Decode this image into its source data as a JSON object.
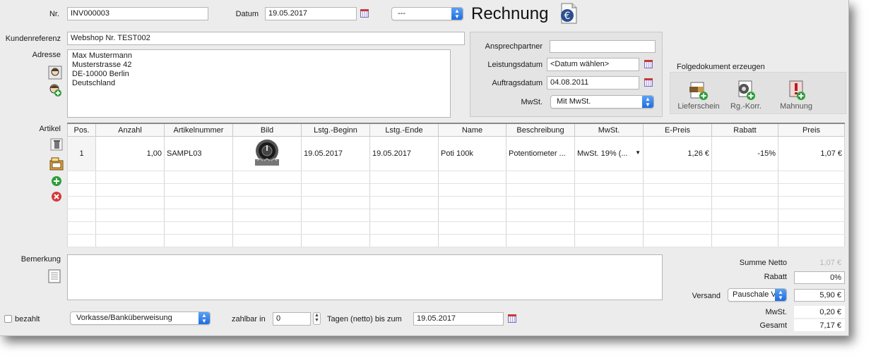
{
  "header": {
    "nr_label": "Nr.",
    "nr_value": "INV000003",
    "datum_label": "Datum",
    "datum_value": "19.05.2017",
    "type_select": "---",
    "doc_title": "Rechnung",
    "kundenreferenz_label": "Kundenreferenz",
    "kundenreferenz_value": "Webshop Nr. TEST002",
    "adresse_label": "Adresse",
    "adresse_lines": [
      "Max Mustermann",
      "Musterstrasse 42",
      "DE-10000 Berlin",
      "Deutschland"
    ]
  },
  "details": {
    "ansprechpartner_label": "Ansprechpartner",
    "ansprechpartner_value": "",
    "leistungsdatum_label": "Leistungsdatum",
    "leistungsdatum_value": "<Datum wählen>",
    "auftragsdatum_label": "Auftragsdatum",
    "auftragsdatum_value": "04.08.2011",
    "mwst_label": "MwSt.",
    "mwst_value": "Mit MwSt."
  },
  "folgedokument": {
    "title": "Folgedokument erzeugen",
    "buttons": [
      "Lieferschein",
      "Rg.-Korr.",
      "Mahnung"
    ]
  },
  "articles": {
    "label": "Artikel",
    "columns": [
      "Pos.",
      "Anzahl",
      "Artikelnummer",
      "Bild",
      "Lstg.-Beginn",
      "Lstg.-Ende",
      "Name",
      "Beschreibung",
      "MwSt.",
      "E-Preis",
      "Rabatt",
      "Preis"
    ],
    "rows": [
      {
        "pos": "1",
        "anzahl": "1,00",
        "artikelnummer": "SAMPL03",
        "lstg_beginn": "19.05.2017",
        "lstg_ende": "19.05.2017",
        "name": "Poti 100k",
        "beschreibung": "Potentiometer ...",
        "mwst": "MwSt. 19% (...",
        "e_preis": "1,26 €",
        "rabatt": "-15%",
        "preis": "1,07 €"
      }
    ]
  },
  "bemerkung": {
    "label": "Bemerkung",
    "value": ""
  },
  "totals": {
    "summe_netto_label": "Summe Netto",
    "summe_netto_value": "1,07 €",
    "rabatt_label": "Rabatt",
    "rabatt_value": "0%",
    "versand_label": "Versand",
    "versand_select": "Pauschale V",
    "versand_value": "5,90 €",
    "mwst_label": "MwSt.",
    "mwst_value": "0,20 €",
    "gesamt_label": "Gesamt",
    "gesamt_value": "7,17 €"
  },
  "footer": {
    "bezahlt_label": "bezahlt",
    "payment_method": "Vorkasse/Banküberweisung",
    "zahlbar_label": "zahlbar in",
    "zahlbar_days": "0",
    "tagen_label": "Tagen (netto) bis zum",
    "due_date": "19.05.2017"
  },
  "colors": {
    "accent": "#1f6de0",
    "window_bg": "#ececec"
  }
}
